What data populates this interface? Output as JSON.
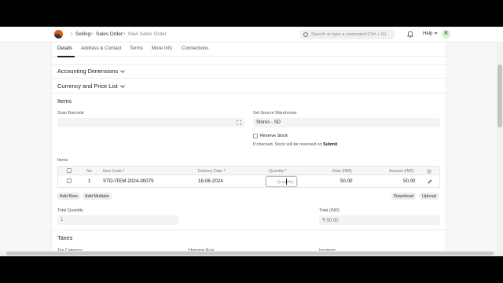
{
  "navbar": {
    "breadcrumbs": [
      "Selling",
      "Sales Order",
      "New Sales Order"
    ],
    "separator": ">",
    "search_placeholder": "Search or type a command (Ctrl + G)",
    "help_label": "Help",
    "avatar_initial": "R"
  },
  "tabs": [
    "Details",
    "Address & Contact",
    "Terms",
    "More Info",
    "Connections"
  ],
  "sections": {
    "accounting_dimensions": "Accounting Dimensions",
    "currency_price_list": "Currency and Price List",
    "items": "Items",
    "taxes": "Taxes"
  },
  "scan_barcode": {
    "label": "Scan Barcode",
    "value": ""
  },
  "source_warehouse": {
    "label": "Set Source Warehouse",
    "value": "Stores - SD"
  },
  "reserve_stock": {
    "label": "Reserve Stock",
    "help_prefix": "If checked, Stock will be reserved on ",
    "help_bold": "Submit"
  },
  "items_table": {
    "label": "Items",
    "headers": {
      "no": "No.",
      "item_code": "Item Code *",
      "delivery_date": "Delivery Date *",
      "quantity": "Quantity *",
      "rate": "Rate (INR)",
      "amount": "Amount (INR)"
    },
    "rows": [
      {
        "no": "1",
        "item_code": "STO-ITEM-2024-00075",
        "delivery_date": "18-06-2024",
        "quantity_placeholder": "Quantity",
        "rate": "50.00",
        "amount": "50.00"
      }
    ],
    "buttons": {
      "add_row": "Add Row",
      "add_multiple": "Add Multiple",
      "download": "Download",
      "upload": "Upload"
    }
  },
  "totals": {
    "total_quantity_label": "Total Quantity",
    "total_quantity_value": "1",
    "total_label": "Total (INR)",
    "total_value": "₹ 50.00"
  },
  "taxes_partial": {
    "col1": "Tax Category",
    "col2": "Shipping Rule",
    "col3": "Incoterm"
  },
  "colors": {
    "accent": "#1f1f1f",
    "avatar_bg": "#d7f0d8",
    "logo": "#e2541a"
  }
}
